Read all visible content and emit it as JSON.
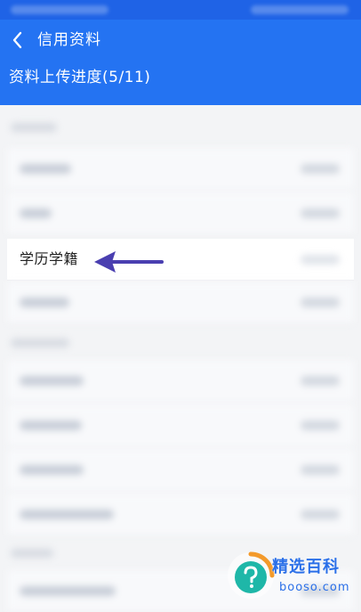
{
  "header": {
    "title": "信用资料",
    "progress_text": "资料上传进度(5/11)",
    "back_icon": "chevron-left-icon"
  },
  "list": {
    "highlighted_item": {
      "label": "学历学籍"
    }
  },
  "annotation": {
    "arrow_icon": "arrow-left-icon",
    "arrow_color": "#4a3fb0"
  },
  "watermark": {
    "title": "精选百科",
    "domain": "booso.com",
    "logo_icon": "question-mark-icon"
  },
  "colors": {
    "header": "#2473f2",
    "status_bar": "#1f63e6",
    "background": "#f3f4f6"
  }
}
